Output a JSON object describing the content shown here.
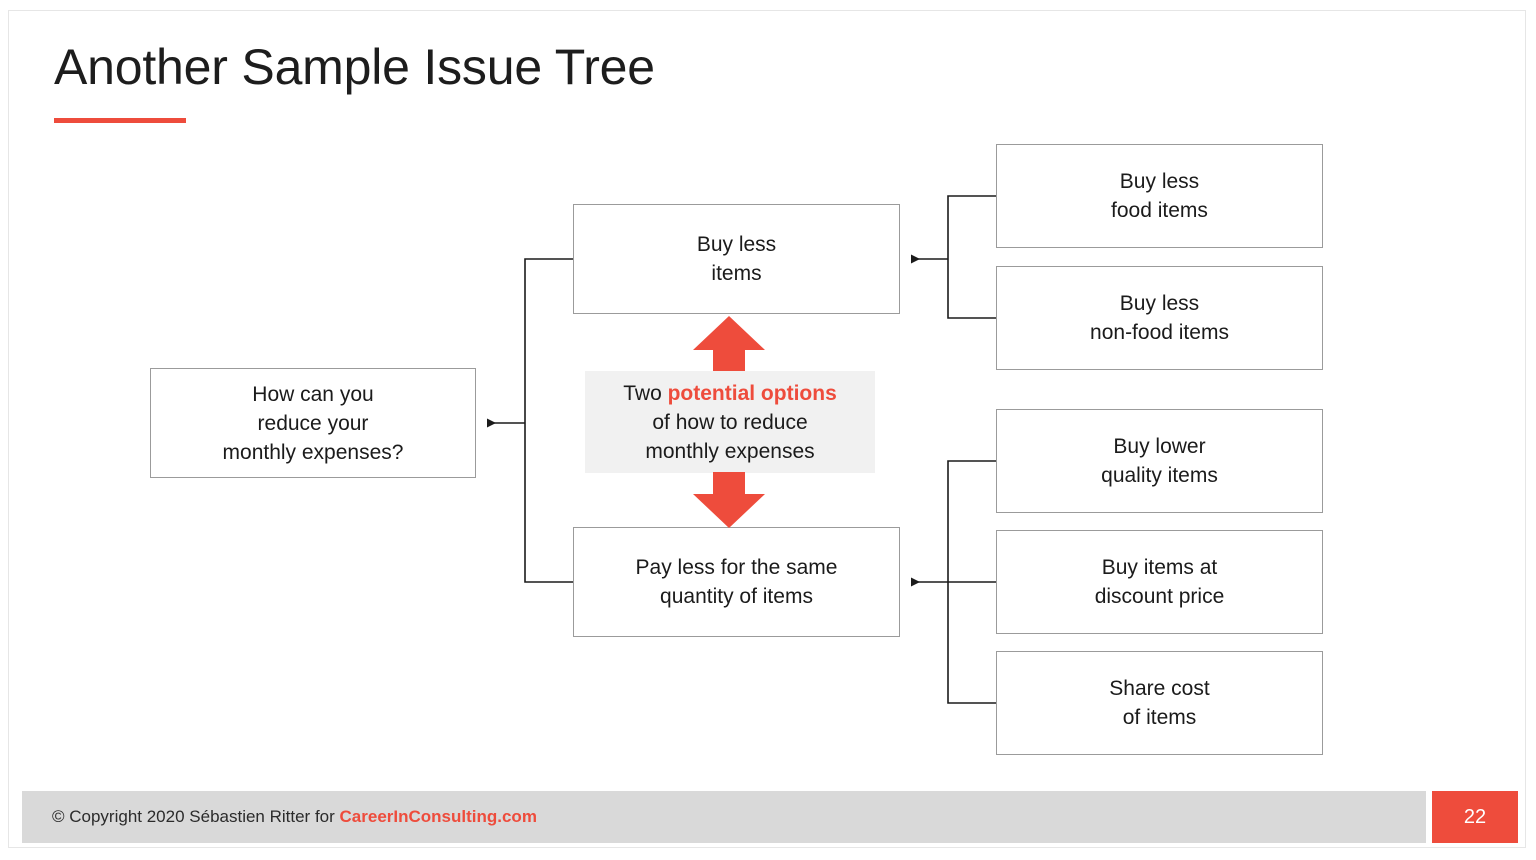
{
  "slide": {
    "title": "Another Sample Issue Tree",
    "page_number": "22",
    "accent_color": "#ee4c3c",
    "border_color": "#9b9b9b",
    "callout_bg": "#f1f1f1",
    "footer_bg": "#d9d9d9"
  },
  "footer": {
    "copyright": "© Copyright 2020 Sébastien Ritter for ",
    "brand": "CareerInConsulting.com"
  },
  "tree": {
    "root": {
      "line1": "How can you",
      "line2": "reduce your",
      "line3": "monthly expenses?"
    },
    "branches": [
      {
        "line1": "Buy less",
        "line2": "items",
        "leaves": [
          {
            "line1": "Buy less",
            "line2": "food items"
          },
          {
            "line1": "Buy less",
            "line2": "non-food items"
          }
        ]
      },
      {
        "line1": "Pay less for the same",
        "line2": "quantity of items",
        "leaves": [
          {
            "line1": "Buy lower",
            "line2": "quality items"
          },
          {
            "line1": "Buy items at",
            "line2": "discount price"
          },
          {
            "line1": "Share cost",
            "line2": "of items"
          }
        ]
      }
    ],
    "callout": {
      "pre": "Two ",
      "highlight": "potential options",
      "line2": "of how to reduce",
      "line3": "monthly expenses"
    }
  }
}
